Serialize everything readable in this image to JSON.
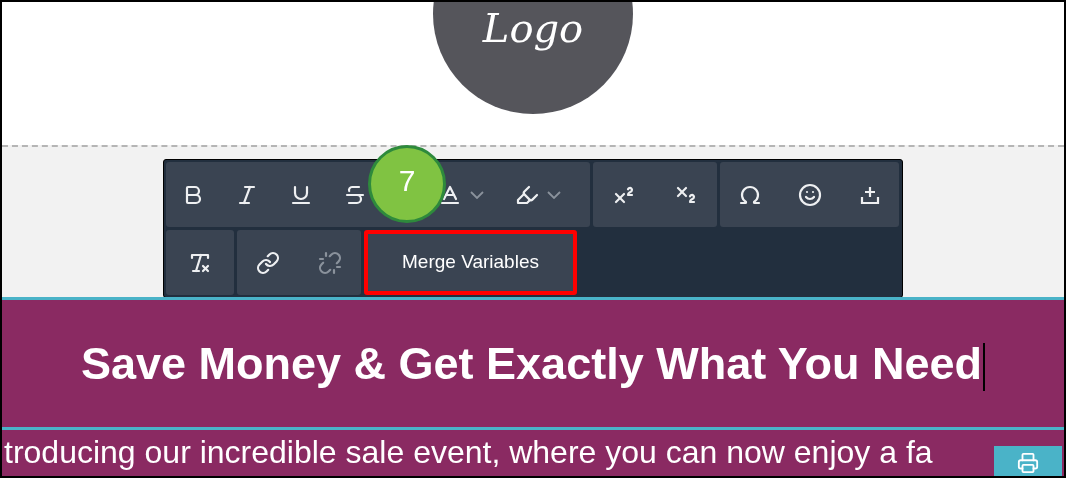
{
  "logo": {
    "text": "Logo"
  },
  "toolbar": {
    "rows": [
      [
        {
          "buttons": [
            {
              "kind": "icon",
              "disabled": false,
              "has_menu": false
            },
            {
              "kind": "icon",
              "disabled": false,
              "has_menu": false
            },
            {
              "kind": "icon",
              "disabled": false,
              "has_menu": false
            },
            {
              "kind": "icon",
              "disabled": false,
              "has_menu": false
            },
            {
              "kind": "icon",
              "disabled": false,
              "has_menu": true
            },
            {
              "kind": "icon",
              "disabled": false,
              "has_menu": true
            }
          ]
        },
        {
          "buttons": [
            {
              "kind": "icon",
              "disabled": false,
              "has_menu": false
            },
            {
              "kind": "icon",
              "disabled": false,
              "has_menu": false
            }
          ]
        },
        {
          "buttons": [
            {
              "kind": "icon",
              "disabled": false,
              "has_menu": false
            },
            {
              "kind": "icon",
              "disabled": false,
              "has_menu": false
            },
            {
              "kind": "icon",
              "disabled": false,
              "has_menu": false
            }
          ]
        }
      ],
      [
        {
          "buttons": [
            {
              "kind": "icon",
              "disabled": false,
              "has_menu": false
            }
          ]
        },
        {
          "buttons": [
            {
              "kind": "icon",
              "disabled": false,
              "has_menu": false
            },
            {
              "kind": "icon",
              "disabled": true,
              "has_menu": false
            }
          ]
        },
        {
          "buttons": [
            {
              "kind": "text",
              "label": "Merge Variables",
              "highlighted": true
            }
          ]
        }
      ]
    ]
  },
  "step_badge": "7",
  "banner": {
    "heading": "Save Money & Get Exactly What You Need",
    "body": "troducing our incredible sale event, where you can now enjoy a fa"
  }
}
